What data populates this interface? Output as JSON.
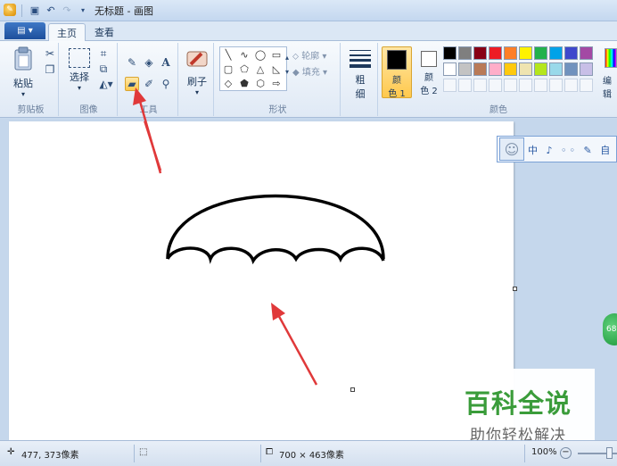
{
  "window": {
    "title": "无标题 - 画图"
  },
  "tabs": [
    {
      "label": "主页",
      "active": true
    },
    {
      "label": "查看",
      "active": false
    }
  ],
  "ribbon": {
    "clipboard": {
      "group_label": "剪贴板",
      "paste_label": "粘贴"
    },
    "image": {
      "group_label": "图像",
      "select_label": "选择"
    },
    "tools": {
      "group_label": "工具",
      "selected_tool": "eraser-icon"
    },
    "brushes": {
      "label": "刷子"
    },
    "shapes": {
      "group_label": "形状",
      "outline_label": "轮廓",
      "fill_label": "填充"
    },
    "size": {
      "label_line1": "粗",
      "label_line2": "细"
    },
    "colors": {
      "group_label": "颜色",
      "color1": {
        "label_line1": "颜",
        "label_line2": "色 1",
        "value": "#000000"
      },
      "color2": {
        "label_line1": "颜",
        "label_line2": "色 2",
        "value": "#ffffff"
      },
      "edit_label": "编辑",
      "palette_row1": [
        "#000000",
        "#7f7f7f",
        "#880015",
        "#ed1c24",
        "#ff7f27",
        "#fff200",
        "#22b14c",
        "#00a2e8",
        "#3f48cc",
        "#a349a4"
      ],
      "palette_row2": [
        "#ffffff",
        "#c3c3c3",
        "#b97a57",
        "#ffaec9",
        "#ffc90e",
        "#efe4b0",
        "#b5e61d",
        "#99d9ea",
        "#7092be",
        "#c8bfe7"
      ]
    }
  },
  "ime_bar": {
    "items": "中 ♪ ◦◦ ✎ 自 ☺"
  },
  "floating_badge": {
    "text": "68"
  },
  "watermark": {
    "title": "百科全说",
    "subtitle": "助你轻松解决"
  },
  "statusbar": {
    "cursor_pos": "477, 373像素",
    "canvas_size": "700 × 463像素",
    "zoom": "100%"
  },
  "accent_colors": {
    "arrow": "#e0393a",
    "selected_tool_bg": "#ffc94d"
  }
}
